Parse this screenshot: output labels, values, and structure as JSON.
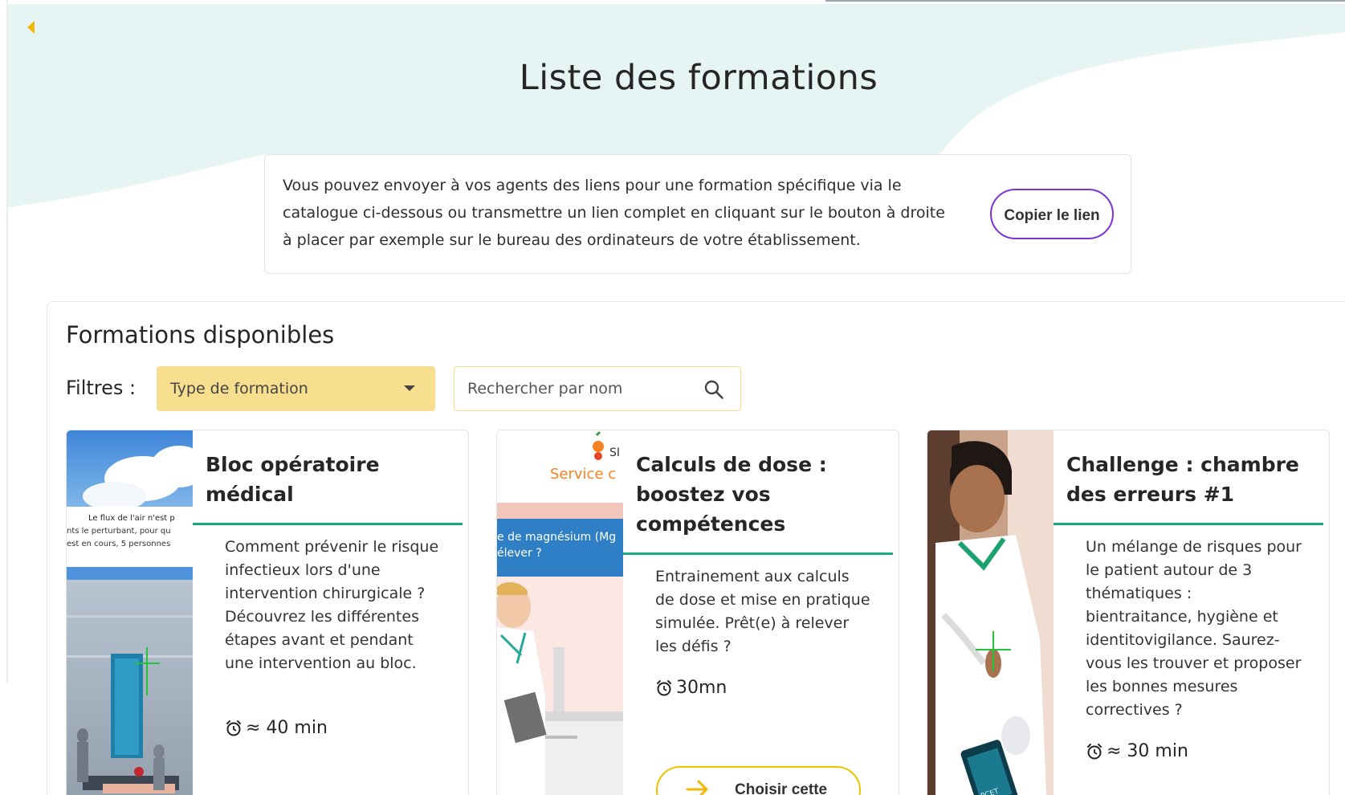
{
  "header": {
    "title": "Liste des formations",
    "back_icon": "chevron-left-icon"
  },
  "info": {
    "text": "Vous pouvez envoyer à vos agents des liens pour une formation spécifique via le catalogue ci-dessous ou transmettre un lien complet en cliquant sur le bouton à droite à placer par exemple sur le bureau des ordinateurs de votre établissement.",
    "copy_button": "Copier le lien"
  },
  "catalog": {
    "title": "Formations disponibles",
    "filters_label": "Filtres :",
    "type_select": "Type de formation",
    "search_placeholder": "Rechercher par nom"
  },
  "cards": [
    {
      "title": "Bloc opératoire médical",
      "description": "Comment prévenir le risque infectieux lors d'une intervention chirurgicale ? Découvrez les différentes étapes avant et pendant une intervention au bloc.",
      "duration": "≈ 40 min",
      "image_text": [
        "Le flux de l'air n'est p",
        "nts le perturbant, pour qu",
        "est en cours, 5 personnes"
      ]
    },
    {
      "title": "Calculs de dose : boostez vos compétences",
      "description": "Entrainement aux calculs de dose et mise en pratique simulée. Prêt(e) à relever les défis ?",
      "duration": "30mn",
      "cta": "Choisir cette",
      "image_text": [
        "SI",
        "Service c",
        "e de magnésium (Mg",
        "élever ?"
      ]
    },
    {
      "title": "Challenge : chambre des erreurs #1",
      "description": "Un mélange de risques pour le patient autour de 3 thématiques : bientraitance, hygiène et identitovigilance. Saurez-vous les trouver et proposer les bonnes mesures correctives ?",
      "duration": "≈ 30 min",
      "image_text": [
        "PCET"
      ]
    }
  ],
  "colors": {
    "accent_purple": "#7b2fd6",
    "accent_yellow": "#f2c200",
    "select_bg": "#f8df8f",
    "title_underline": "#1aaa82",
    "wave_bg": "#e6f5f3"
  }
}
